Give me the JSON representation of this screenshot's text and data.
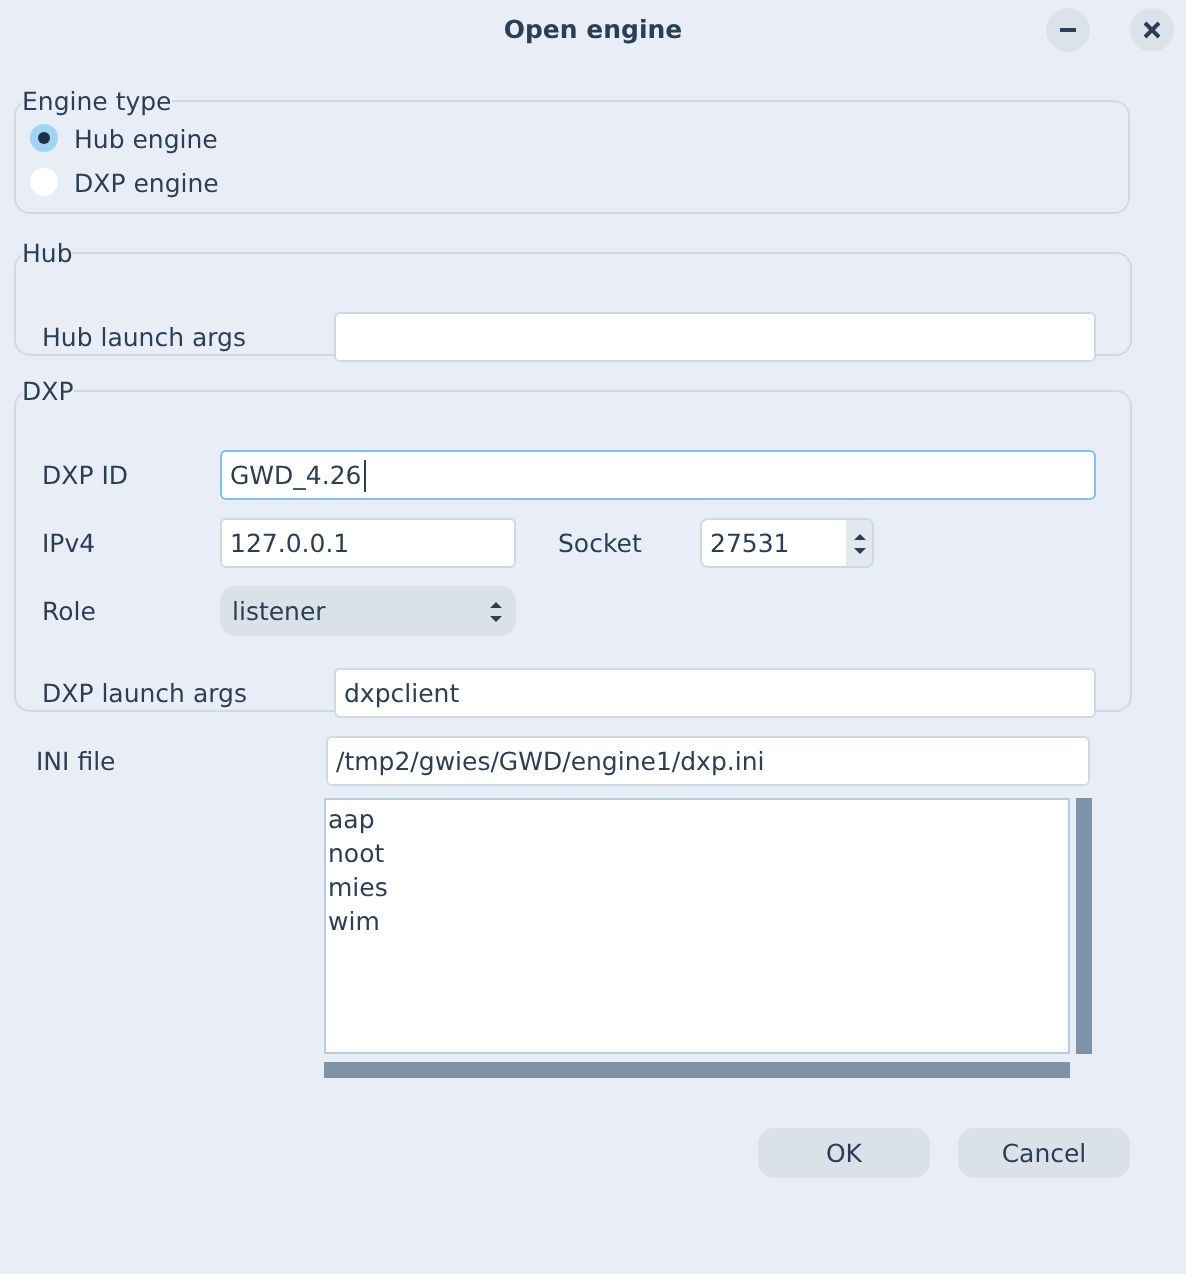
{
  "window": {
    "title": "Open engine"
  },
  "engine_type": {
    "title": "Engine type",
    "options": [
      {
        "label": "Hub engine",
        "selected": true
      },
      {
        "label": "DXP engine",
        "selected": false
      }
    ]
  },
  "hub": {
    "title": "Hub",
    "launch_args": {
      "label": "Hub launch args"
    }
  },
  "dxp": {
    "title": "DXP",
    "id": {
      "label": "DXP ID",
      "value": "GWD_4.26",
      "focused": true
    },
    "ipv4": {
      "label": "IPv4",
      "value": "127.0.0.1"
    },
    "socket": {
      "label": "Socket",
      "value": "27531"
    },
    "role": {
      "label": "Role",
      "value": "listener"
    },
    "launch_args": {
      "label": "DXP launch args",
      "value": "dxpclient"
    }
  },
  "ini_file": {
    "label": "INI file",
    "value": "/tmp2/gwies/GWD/engine1/dxp.ini"
  },
  "list": {
    "items": [
      "aap",
      "noot",
      "mies",
      "wim"
    ]
  },
  "buttons": [
    {
      "label": "OK"
    },
    {
      "label": "Cancel"
    }
  ]
}
